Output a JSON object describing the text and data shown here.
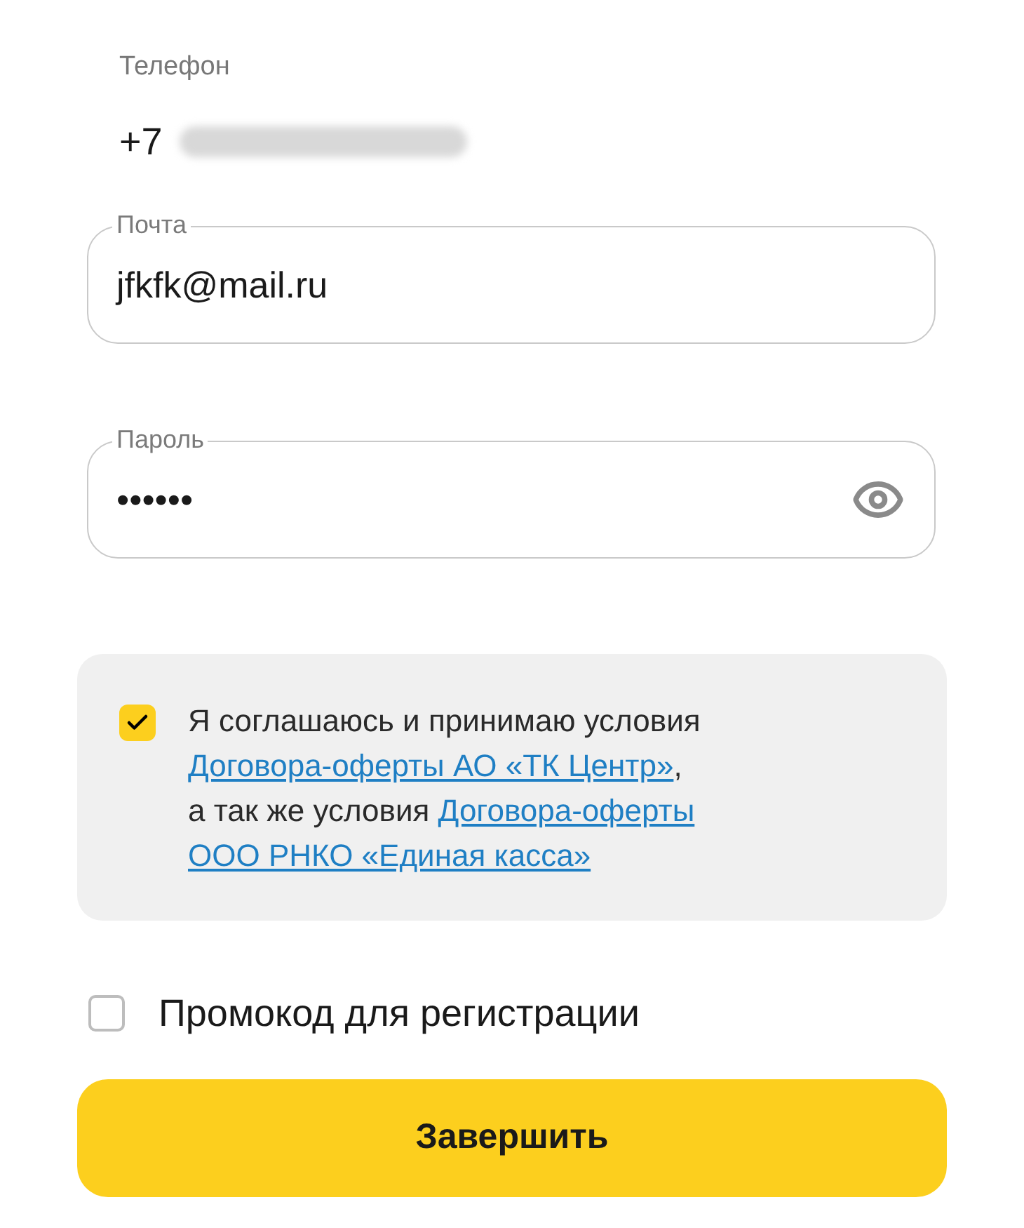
{
  "phone": {
    "label": "Телефон",
    "prefix": "+7"
  },
  "email": {
    "label": "Почта",
    "value": "jfkfk@mail.ru"
  },
  "password": {
    "label": "Пароль",
    "value": "••••••"
  },
  "agreement": {
    "checked": true,
    "lines": [
      [
        {
          "kind": "text",
          "text": "Я соглашаюсь и принимаю условия"
        }
      ],
      [
        {
          "kind": "link",
          "text": "Договора-оферты АО «ТК Центр»"
        },
        {
          "kind": "text",
          "text": ","
        }
      ],
      [
        {
          "kind": "text",
          "text": "а так же условия "
        },
        {
          "kind": "link",
          "text": "Договора-оферты "
        }
      ],
      [
        {
          "kind": "link",
          "text": "ООО РНКО «Единая касса»"
        }
      ]
    ]
  },
  "promo": {
    "checked": false,
    "label": "Промокод для регистрации"
  },
  "submit": {
    "label": "Завершить"
  }
}
